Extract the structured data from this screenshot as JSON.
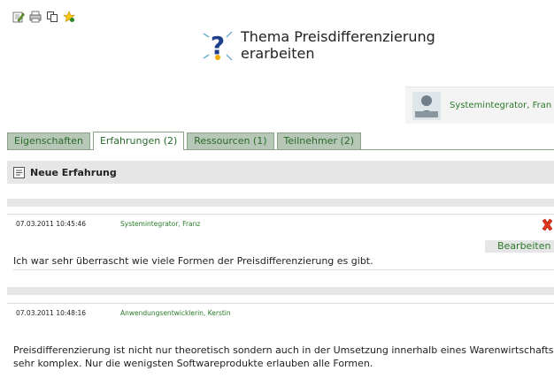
{
  "toolbar": {
    "icons": [
      "edit-icon",
      "print-icon",
      "copy-icon",
      "favorite-star-icon"
    ]
  },
  "header": {
    "title_line1": "Thema Preisdifferenzierung",
    "title_line2": "erarbeiten",
    "icon": "question-mark-icon"
  },
  "user": {
    "name": "Systemintegrator, Fran",
    "avatar": "user-avatar-icon"
  },
  "tabs": [
    {
      "label": "Eigenschaften"
    },
    {
      "label": "Erfahrungen (2)",
      "active": true
    },
    {
      "label": "Ressourcen (1)"
    },
    {
      "label": "Teilnehmer (2)"
    }
  ],
  "section": {
    "title": "Neue Erfahrung",
    "icon": "new-entry-icon"
  },
  "entries": [
    {
      "date": "07.03.2011 10:45:46",
      "author": "Systemintegrator, Franz",
      "edit_label": "Bearbeiten",
      "text_lines": [
        "Ich war sehr überrascht wie viele Formen der Preisdifferenzierung es gibt."
      ]
    },
    {
      "date": "07.03.2011 10:48:16",
      "author": "Anwendungsentwicklerin, Kerstin",
      "text_lines": [
        "Preisdifferenzierung ist nicht nur theoretisch sondern auch in der Umsetzung innerhalb eines Warenwirtschaftssystems",
        "sehr komplex. Nur die wenigsten Softwareprodukte erlauben alle Formen."
      ]
    }
  ],
  "colors": {
    "accent_green": "#2a7a2a",
    "tab_bg": "#b7c7b7",
    "section_bg": "#e6e6e6",
    "delete_red": "#e0341c"
  }
}
